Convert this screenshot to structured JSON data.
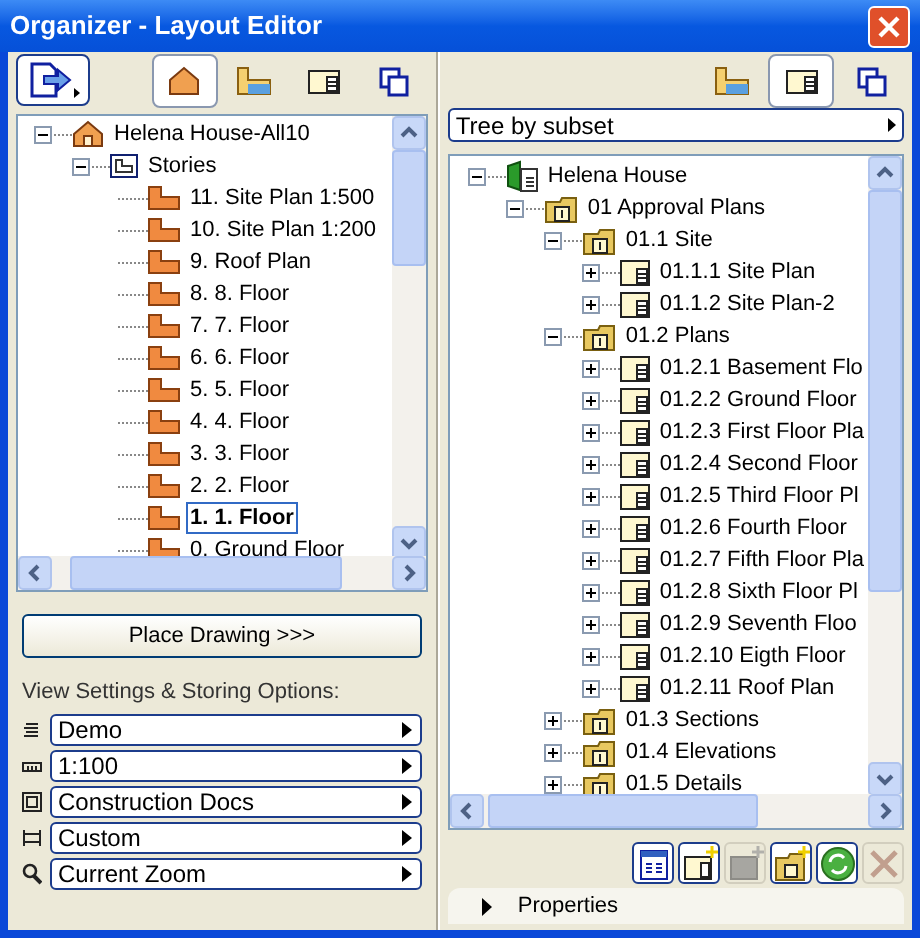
{
  "window": {
    "title": "Organizer - Layout Editor"
  },
  "left_panel": {
    "tabs": [
      {
        "selected": true
      },
      {
        "selected": false
      },
      {
        "selected": false
      },
      {
        "selected": false
      }
    ],
    "tree": [
      {
        "kind": "house",
        "label": "Helena House-All10",
        "expanded": true,
        "selected": false,
        "children": [
          {
            "kind": "stories",
            "label": "Stories",
            "expanded": true,
            "selected": false,
            "children": [
              {
                "kind": "story",
                "label": "11. Site Plan 1:500",
                "selected": false
              },
              {
                "kind": "story",
                "label": "10. Site Plan 1:200",
                "selected": false
              },
              {
                "kind": "story",
                "label": "9. Roof Plan",
                "selected": false
              },
              {
                "kind": "story",
                "label": "8. 8. Floor",
                "selected": false
              },
              {
                "kind": "story",
                "label": "7. 7. Floor",
                "selected": false
              },
              {
                "kind": "story",
                "label": "6. 6. Floor",
                "selected": false
              },
              {
                "kind": "story",
                "label": "5. 5. Floor",
                "selected": false
              },
              {
                "kind": "story",
                "label": "4. 4. Floor",
                "selected": false
              },
              {
                "kind": "story",
                "label": "3. 3. Floor",
                "selected": false
              },
              {
                "kind": "story",
                "label": "2. 2. Floor",
                "selected": false
              },
              {
                "kind": "story",
                "label": "1. 1. Floor",
                "selected": true
              },
              {
                "kind": "story",
                "label": "0. Ground Floor",
                "selected": false
              }
            ]
          }
        ]
      }
    ],
    "place_button": "Place Drawing >>>",
    "options_label": "View Settings & Storing Options:",
    "options": [
      {
        "kind": "layers",
        "value": "Demo"
      },
      {
        "kind": "scale",
        "value": "1:100"
      },
      {
        "kind": "model",
        "value": "Construction Docs"
      },
      {
        "kind": "dimension",
        "value": "Custom"
      },
      {
        "kind": "zoom",
        "value": "Current Zoom"
      }
    ]
  },
  "right_panel": {
    "tabs": [
      {
        "selected": false
      },
      {
        "selected": true
      },
      {
        "selected": false
      }
    ],
    "view_mode": "Tree by subset",
    "tree": [
      {
        "kind": "project",
        "label": "Helena House",
        "expanded": true,
        "selected": false,
        "children": [
          {
            "kind": "folder",
            "label": "01 Approval Plans",
            "expanded": true,
            "selected": false,
            "children": [
              {
                "kind": "folder",
                "label": "01.1 Site",
                "expanded": true,
                "selected": false,
                "children": [
                  {
                    "kind": "layout",
                    "label": "01.1.1 Site Plan",
                    "expanded": false,
                    "selected": false
                  },
                  {
                    "kind": "layout",
                    "label": "01.1.2 Site Plan-2",
                    "expanded": false,
                    "selected": false
                  }
                ]
              },
              {
                "kind": "folder",
                "label": "01.2 Plans",
                "expanded": true,
                "selected": false,
                "children": [
                  {
                    "kind": "layout",
                    "label": "01.2.1 Basement Flo",
                    "expanded": false,
                    "selected": false
                  },
                  {
                    "kind": "layout",
                    "label": "01.2.2 Ground Floor",
                    "expanded": false,
                    "selected": false
                  },
                  {
                    "kind": "layout",
                    "label": "01.2.3 First Floor Pla",
                    "expanded": false,
                    "selected": false
                  },
                  {
                    "kind": "layout",
                    "label": "01.2.4 Second Floor",
                    "expanded": false,
                    "selected": false
                  },
                  {
                    "kind": "layout",
                    "label": "01.2.5 Third Floor Pl",
                    "expanded": false,
                    "selected": false
                  },
                  {
                    "kind": "layout",
                    "label": "01.2.6 Fourth Floor",
                    "expanded": false,
                    "selected": false
                  },
                  {
                    "kind": "layout",
                    "label": "01.2.7 Fifth Floor Pla",
                    "expanded": false,
                    "selected": false
                  },
                  {
                    "kind": "layout",
                    "label": "01.2.8 Sixth Floor Pl",
                    "expanded": false,
                    "selected": false
                  },
                  {
                    "kind": "layout",
                    "label": "01.2.9 Seventh Floo",
                    "expanded": false,
                    "selected": false
                  },
                  {
                    "kind": "layout",
                    "label": "01.2.10 Eigth Floor",
                    "expanded": false,
                    "selected": false
                  },
                  {
                    "kind": "layout",
                    "label": "01.2.11 Roof Plan",
                    "expanded": false,
                    "selected": false
                  }
                ]
              },
              {
                "kind": "folder",
                "label": "01.3 Sections",
                "expanded": false,
                "selected": false
              },
              {
                "kind": "folder",
                "label": "01.4 Elevations",
                "expanded": false,
                "selected": false
              },
              {
                "kind": "folder",
                "label": "01.5 Details",
                "expanded": false,
                "selected": false
              }
            ]
          }
        ]
      }
    ],
    "buttons": [
      {
        "disabled": false
      },
      {
        "disabled": false
      },
      {
        "disabled": true
      },
      {
        "disabled": false
      },
      {
        "disabled": false
      },
      {
        "disabled": true
      }
    ],
    "properties": {
      "label": "Properties",
      "expanded": false
    }
  }
}
